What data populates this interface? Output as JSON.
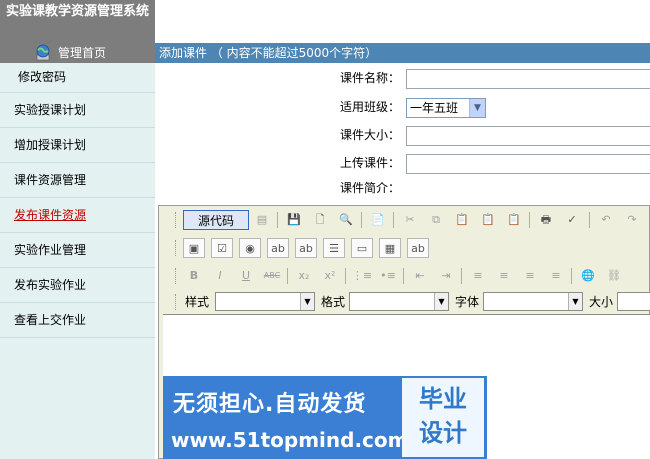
{
  "app": {
    "title": "实验课教学资源管理系统",
    "home_label": "管理首页"
  },
  "menu": {
    "items": [
      {
        "label": "修改密码"
      },
      {
        "label": "实验授课计划"
      },
      {
        "label": "增加授课计划"
      },
      {
        "label": "课件资源管理"
      },
      {
        "label": "发布课件资源"
      },
      {
        "label": "实验作业管理"
      },
      {
        "label": "发布实验作业"
      },
      {
        "label": "查看上交作业"
      }
    ],
    "active_index": 4
  },
  "panel": {
    "title": "添加课件 （ 内容不能超过5000个字符）",
    "fields": {
      "name_label": "课件名称：",
      "class_label": "适用班级：",
      "class_value": "一年五班",
      "size_label": "课件大小：",
      "upload_label": "上传课件：",
      "intro_label": "课件简介："
    }
  },
  "editor": {
    "source_button": "源代码",
    "style_label": "样式",
    "format_label": "格式",
    "font_label": "字体",
    "size_label": "大小",
    "bold": "B",
    "italic": "I",
    "underline": "U",
    "strike": "ABC"
  },
  "banner": {
    "line1": "无须担心.自动发货",
    "line2": "www.51topmind.com",
    "badge": "毕业设计"
  },
  "colors": {
    "sidebar_bg": "#e4f1f1",
    "header_gray": "#7d7d7d",
    "panel_head": "#4d86b5",
    "active_menu": "#c00000",
    "banner": "#3a7fd3"
  }
}
